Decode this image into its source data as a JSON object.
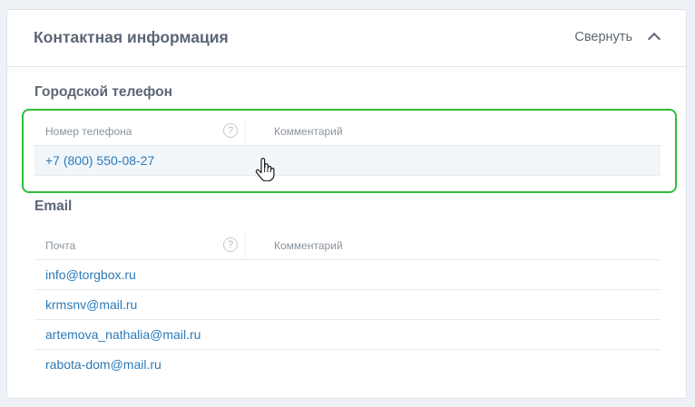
{
  "card": {
    "title": "Контактная информация",
    "collapse_label": "Свернуть",
    "collapse_icon": "chevron-up-icon"
  },
  "phone_section": {
    "title": "Городской телефон",
    "columns": {
      "number": "Номер телефона",
      "help": "?",
      "comment": "Комментарий"
    },
    "rows": [
      {
        "number": "+7 (800) 550-08-27",
        "comment": ""
      }
    ],
    "highlight_color": "#2dbd3a"
  },
  "email_section": {
    "title": "Email",
    "columns": {
      "email": "Почта",
      "help": "?",
      "comment": "Комментарий"
    },
    "rows": [
      {
        "email": "info@torgbox.ru",
        "comment": ""
      },
      {
        "email": "krmsnv@mail.ru",
        "comment": ""
      },
      {
        "email": "artemova_nathalia@mail.ru",
        "comment": ""
      },
      {
        "email": "rabota-dom@mail.ru",
        "comment": ""
      }
    ]
  },
  "colors": {
    "link": "#2b7ab9",
    "text": "#5c6675",
    "muted": "#8a939e"
  }
}
